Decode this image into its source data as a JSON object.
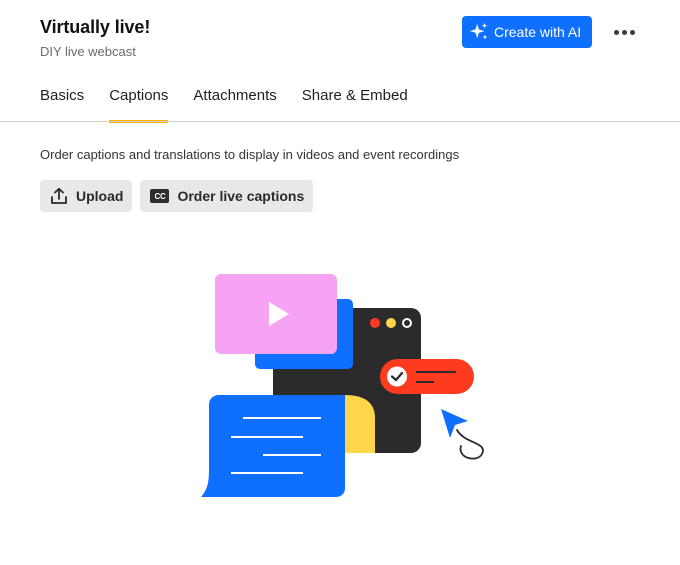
{
  "header": {
    "title": "Virtually live!",
    "subtitle": "DIY live webcast"
  },
  "toolbar": {
    "ai_button_label": "Create with AI",
    "ai_icon": "sparkles-icon",
    "more_icon": "more-horizontal-icon",
    "accent_color": "#0f6fff"
  },
  "tabs": [
    {
      "label": "Basics",
      "active": false
    },
    {
      "label": "Captions",
      "active": true
    },
    {
      "label": "Attachments",
      "active": false
    },
    {
      "label": "Share & Embed",
      "active": false
    }
  ],
  "tab_indicator_color": "#f5b300",
  "main": {
    "description": "Order captions and translations to display in videos and event recordings",
    "upload_label": "Upload",
    "upload_icon": "upload-icon",
    "order_label": "Order live captions",
    "order_icon_text": "CC",
    "illustration": "captions-illustration"
  }
}
